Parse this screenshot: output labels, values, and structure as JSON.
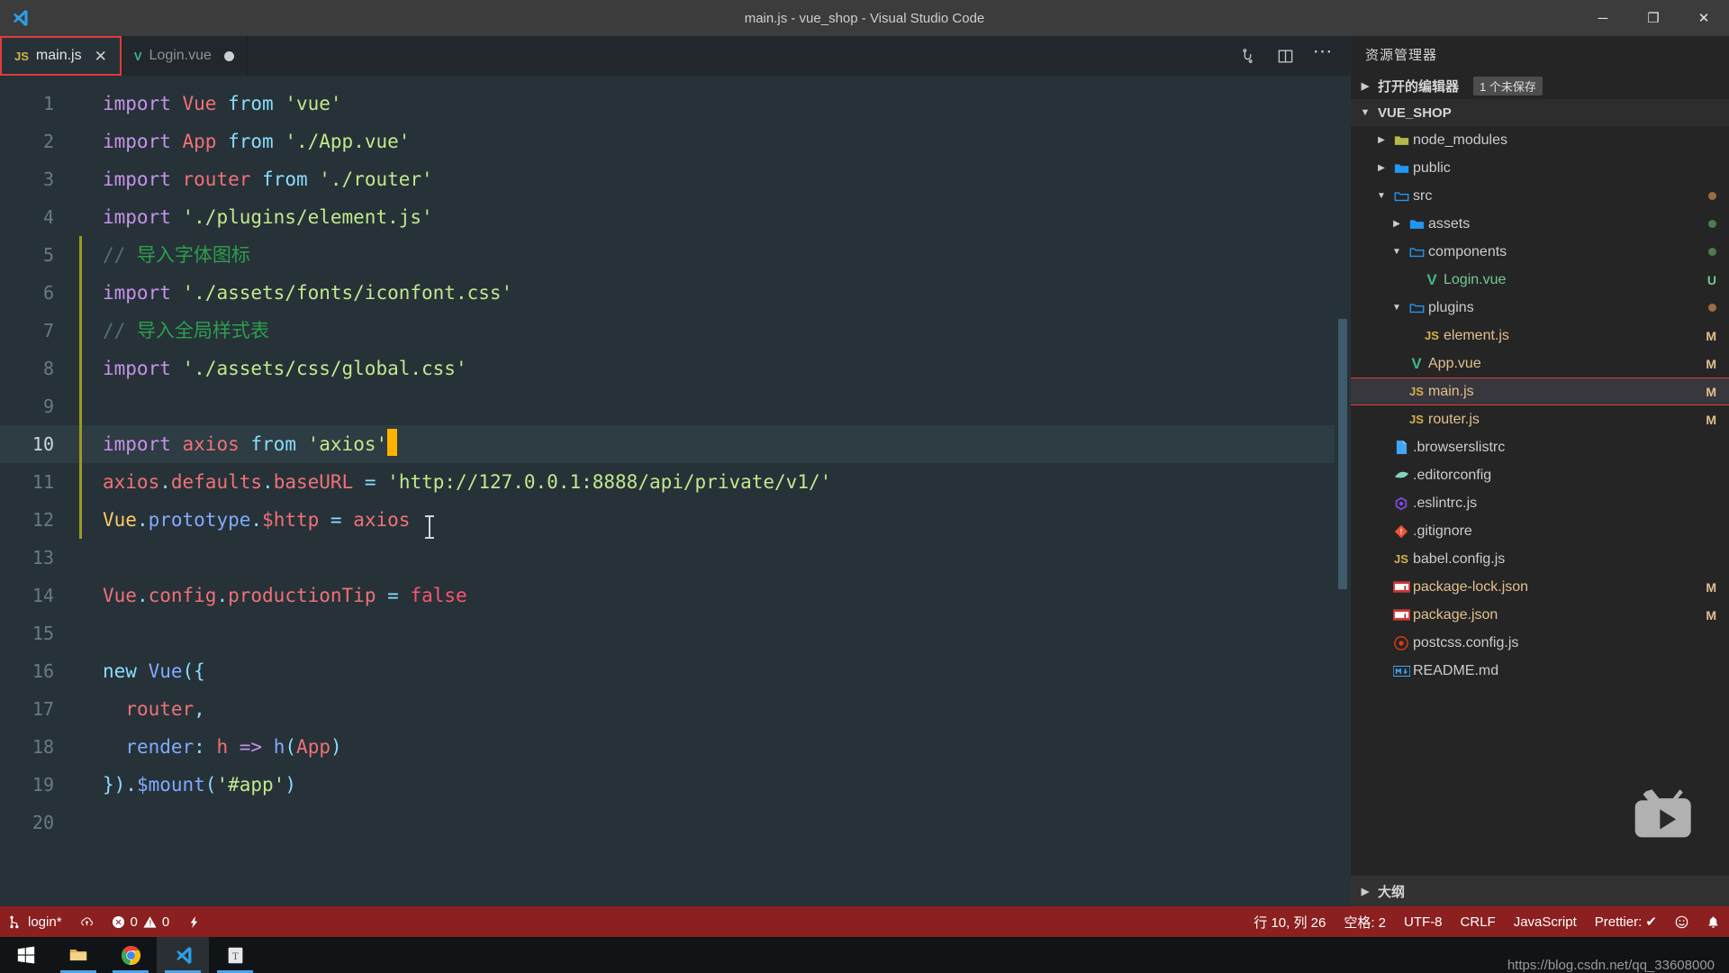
{
  "window": {
    "title": "main.js - vue_shop - Visual Studio Code",
    "minimize_label": "─",
    "maximize_label": "❐",
    "close_label": "✕"
  },
  "tabs": [
    {
      "label": "main.js",
      "icon": "js-file-icon",
      "active": true,
      "dirty": false,
      "close_label": "✕"
    },
    {
      "label": "Login.vue",
      "icon": "vue-file-icon",
      "active": false,
      "dirty": true,
      "close_label": ""
    }
  ],
  "editor_actions": [
    {
      "name": "run-and-debug-icon",
      "label": ""
    },
    {
      "name": "split-editor-icon",
      "label": ""
    },
    {
      "name": "more-actions-icon",
      "label": "⋯"
    }
  ],
  "code": {
    "lines": [
      {
        "n": "1",
        "tokens": [
          {
            "t": "kw",
            "v": "import"
          },
          {
            "t": "plain",
            "v": " "
          },
          {
            "t": "var",
            "v": "Vue"
          },
          {
            "t": "plain",
            "v": " "
          },
          {
            "t": "from",
            "v": "from"
          },
          {
            "t": "plain",
            "v": " "
          },
          {
            "t": "str",
            "v": "'vue'"
          }
        ]
      },
      {
        "n": "2",
        "tokens": [
          {
            "t": "kw",
            "v": "import"
          },
          {
            "t": "plain",
            "v": " "
          },
          {
            "t": "var",
            "v": "App"
          },
          {
            "t": "plain",
            "v": " "
          },
          {
            "t": "from",
            "v": "from"
          },
          {
            "t": "plain",
            "v": " "
          },
          {
            "t": "str",
            "v": "'./App.vue'"
          }
        ]
      },
      {
        "n": "3",
        "tokens": [
          {
            "t": "kw",
            "v": "import"
          },
          {
            "t": "plain",
            "v": " "
          },
          {
            "t": "var",
            "v": "router"
          },
          {
            "t": "plain",
            "v": " "
          },
          {
            "t": "from",
            "v": "from"
          },
          {
            "t": "plain",
            "v": " "
          },
          {
            "t": "str",
            "v": "'./router'"
          }
        ]
      },
      {
        "n": "4",
        "tokens": [
          {
            "t": "kw",
            "v": "import"
          },
          {
            "t": "plain",
            "v": " "
          },
          {
            "t": "str",
            "v": "'./plugins/element.js'"
          }
        ]
      },
      {
        "n": "5",
        "fold": true,
        "tokens": [
          {
            "t": "cmt",
            "v": "// "
          },
          {
            "t": "cmt-cn",
            "v": "导入字体图标"
          }
        ]
      },
      {
        "n": "6",
        "fold": true,
        "tokens": [
          {
            "t": "kw",
            "v": "import"
          },
          {
            "t": "plain",
            "v": " "
          },
          {
            "t": "str",
            "v": "'./assets/fonts/iconfont.css'"
          }
        ]
      },
      {
        "n": "7",
        "fold": true,
        "tokens": [
          {
            "t": "cmt",
            "v": "// "
          },
          {
            "t": "cmt-cn",
            "v": "导入全局样式表"
          }
        ]
      },
      {
        "n": "8",
        "fold": true,
        "tokens": [
          {
            "t": "kw",
            "v": "import"
          },
          {
            "t": "plain",
            "v": " "
          },
          {
            "t": "str",
            "v": "'./assets/css/global.css'"
          }
        ]
      },
      {
        "n": "9",
        "fold": true,
        "tokens": []
      },
      {
        "n": "10",
        "fold": true,
        "current": true,
        "caret": true,
        "tokens": [
          {
            "t": "kw",
            "v": "import"
          },
          {
            "t": "plain",
            "v": " "
          },
          {
            "t": "var",
            "v": "axios"
          },
          {
            "t": "plain",
            "v": " "
          },
          {
            "t": "from",
            "v": "from"
          },
          {
            "t": "plain",
            "v": " "
          },
          {
            "t": "str",
            "v": "'axios'"
          }
        ]
      },
      {
        "n": "11",
        "fold": true,
        "tokens": [
          {
            "t": "var",
            "v": "axios"
          },
          {
            "t": "punc",
            "v": "."
          },
          {
            "t": "var",
            "v": "defaults"
          },
          {
            "t": "punc",
            "v": "."
          },
          {
            "t": "var",
            "v": "baseURL"
          },
          {
            "t": "plain",
            "v": " "
          },
          {
            "t": "op",
            "v": "="
          },
          {
            "t": "plain",
            "v": " "
          },
          {
            "t": "str",
            "v": "'http://127.0.0.1:8888/api/private/v1/'"
          }
        ]
      },
      {
        "n": "12",
        "fold": true,
        "tokens": [
          {
            "t": "yellow",
            "v": "Vue"
          },
          {
            "t": "punc",
            "v": "."
          },
          {
            "t": "prop",
            "v": "prototype"
          },
          {
            "t": "punc",
            "v": "."
          },
          {
            "t": "var",
            "v": "$http"
          },
          {
            "t": "plain",
            "v": " "
          },
          {
            "t": "op",
            "v": "="
          },
          {
            "t": "plain",
            "v": " "
          },
          {
            "t": "var",
            "v": "axios"
          }
        ]
      },
      {
        "n": "13",
        "tokens": []
      },
      {
        "n": "14",
        "tokens": [
          {
            "t": "var",
            "v": "Vue"
          },
          {
            "t": "punc",
            "v": "."
          },
          {
            "t": "var",
            "v": "config"
          },
          {
            "t": "punc",
            "v": "."
          },
          {
            "t": "var",
            "v": "productionTip"
          },
          {
            "t": "plain",
            "v": " "
          },
          {
            "t": "op",
            "v": "="
          },
          {
            "t": "plain",
            "v": " "
          },
          {
            "t": "red",
            "v": "false"
          }
        ]
      },
      {
        "n": "15",
        "tokens": []
      },
      {
        "n": "16",
        "tokens": [
          {
            "t": "from",
            "v": "new"
          },
          {
            "t": "plain",
            "v": " "
          },
          {
            "t": "fn",
            "v": "Vue"
          },
          {
            "t": "punc",
            "v": "({"
          }
        ]
      },
      {
        "n": "17",
        "tokens": [
          {
            "t": "plain",
            "v": "  "
          },
          {
            "t": "var",
            "v": "router"
          },
          {
            "t": "punc",
            "v": ","
          }
        ]
      },
      {
        "n": "18",
        "tokens": [
          {
            "t": "plain",
            "v": "  "
          },
          {
            "t": "prop",
            "v": "render"
          },
          {
            "t": "punc",
            "v": ":"
          },
          {
            "t": "plain",
            "v": " "
          },
          {
            "t": "var",
            "v": "h"
          },
          {
            "t": "plain",
            "v": " "
          },
          {
            "t": "kw",
            "v": "=>"
          },
          {
            "t": "plain",
            "v": " "
          },
          {
            "t": "fn",
            "v": "h"
          },
          {
            "t": "punc",
            "v": "("
          },
          {
            "t": "var",
            "v": "App"
          },
          {
            "t": "punc",
            "v": ")"
          }
        ]
      },
      {
        "n": "19",
        "tokens": [
          {
            "t": "punc",
            "v": "})."
          },
          {
            "t": "fn",
            "v": "$mount"
          },
          {
            "t": "punc",
            "v": "("
          },
          {
            "t": "str",
            "v": "'#app'"
          },
          {
            "t": "punc",
            "v": ")"
          }
        ]
      },
      {
        "n": "20",
        "tokens": []
      }
    ]
  },
  "sidebar": {
    "title": "资源管理器",
    "open_editors": {
      "label": "打开的编辑器",
      "badge": "1 个未保存",
      "expanded": false
    },
    "project": {
      "label": "VUE_SHOP",
      "expanded": true
    },
    "tree": [
      {
        "name": "node_modules",
        "icon": "folder-node-icon",
        "indent": 1,
        "twisty": "collapsed",
        "status": "",
        "dot": ""
      },
      {
        "name": "public",
        "icon": "folder-icon",
        "indent": 1,
        "twisty": "collapsed",
        "status": "",
        "dot": ""
      },
      {
        "name": "src",
        "icon": "folder-open-icon",
        "indent": 1,
        "twisty": "expanded",
        "status": "",
        "dot": "#9a6c3f"
      },
      {
        "name": "assets",
        "icon": "folder-icon",
        "indent": 2,
        "twisty": "collapsed",
        "status": "",
        "dot": "#4f7a52"
      },
      {
        "name": "components",
        "icon": "folder-open-icon",
        "indent": 2,
        "twisty": "expanded",
        "status": "",
        "dot": "#4f7a52"
      },
      {
        "name": "Login.vue",
        "icon": "vue-file-icon",
        "indent": 3,
        "twisty": "none",
        "status": "U",
        "dot": ""
      },
      {
        "name": "plugins",
        "icon": "folder-open-icon",
        "indent": 2,
        "twisty": "expanded",
        "status": "",
        "dot": "#9a6c3f"
      },
      {
        "name": "element.js",
        "icon": "js-file-icon",
        "indent": 3,
        "twisty": "none",
        "status": "M",
        "dot": ""
      },
      {
        "name": "App.vue",
        "icon": "vue-file-icon",
        "indent": 2,
        "twisty": "none",
        "status": "M",
        "dot": ""
      },
      {
        "name": "main.js",
        "icon": "js-file-icon",
        "indent": 2,
        "twisty": "none",
        "status": "M",
        "dot": "",
        "selected": true
      },
      {
        "name": "router.js",
        "icon": "js-file-icon",
        "indent": 2,
        "twisty": "none",
        "status": "M",
        "dot": ""
      },
      {
        "name": ".browserslistrc",
        "icon": "text-file-icon",
        "indent": 1,
        "twisty": "none",
        "status": "",
        "dot": ""
      },
      {
        "name": ".editorconfig",
        "icon": "editorconfig-icon",
        "indent": 1,
        "twisty": "none",
        "status": "",
        "dot": ""
      },
      {
        "name": ".eslintrc.js",
        "icon": "eslint-icon",
        "indent": 1,
        "twisty": "none",
        "status": "",
        "dot": ""
      },
      {
        "name": ".gitignore",
        "icon": "git-icon",
        "indent": 1,
        "twisty": "none",
        "status": "",
        "dot": ""
      },
      {
        "name": "babel.config.js",
        "icon": "js-file-icon",
        "indent": 1,
        "twisty": "none",
        "status": "",
        "dot": ""
      },
      {
        "name": "package-lock.json",
        "icon": "npm-icon",
        "indent": 1,
        "twisty": "none",
        "status": "M",
        "dot": ""
      },
      {
        "name": "package.json",
        "icon": "npm-icon",
        "indent": 1,
        "twisty": "none",
        "status": "M",
        "dot": ""
      },
      {
        "name": "postcss.config.js",
        "icon": "postcss-icon",
        "indent": 1,
        "twisty": "none",
        "status": "",
        "dot": ""
      },
      {
        "name": "README.md",
        "icon": "markdown-icon",
        "indent": 1,
        "twisty": "none",
        "status": "",
        "dot": ""
      }
    ],
    "outline": {
      "label": "大纲",
      "expanded": false
    },
    "watermark_logo": "bilibili-tv-icon"
  },
  "statusbar": {
    "branch": "login*",
    "sync_icon": "cloud-sync-icon",
    "errors": "0",
    "warnings": "0",
    "ports_icon": "radio-tower-icon",
    "cursor_position": "行 10, 列 26",
    "indentation": "空格: 2",
    "encoding": "UTF-8",
    "eol": "CRLF",
    "language": "JavaScript",
    "formatter": "Prettier: ✔",
    "feedback_icon": "smiley-icon",
    "notifications_icon": "bell-icon"
  },
  "taskbar": {
    "items": [
      {
        "name": "start-button",
        "icon": "windows-icon",
        "active": false,
        "running": false
      },
      {
        "name": "file-explorer",
        "icon": "folder-icon",
        "active": false,
        "running": true
      },
      {
        "name": "google-chrome",
        "icon": "chrome-icon",
        "active": false,
        "running": true
      },
      {
        "name": "visual-studio-code",
        "icon": "vscode-icon",
        "active": true,
        "running": true
      },
      {
        "name": "text-editor",
        "icon": "typora-icon",
        "active": false,
        "running": true
      }
    ],
    "watermark": "https://blog.csdn.net/qq_33608000"
  },
  "colors": {
    "accent_red": "#e03a3a",
    "statusbar_bg": "#8c1f1f",
    "editor_bg": "#263238",
    "sidebar_bg": "#252526"
  }
}
